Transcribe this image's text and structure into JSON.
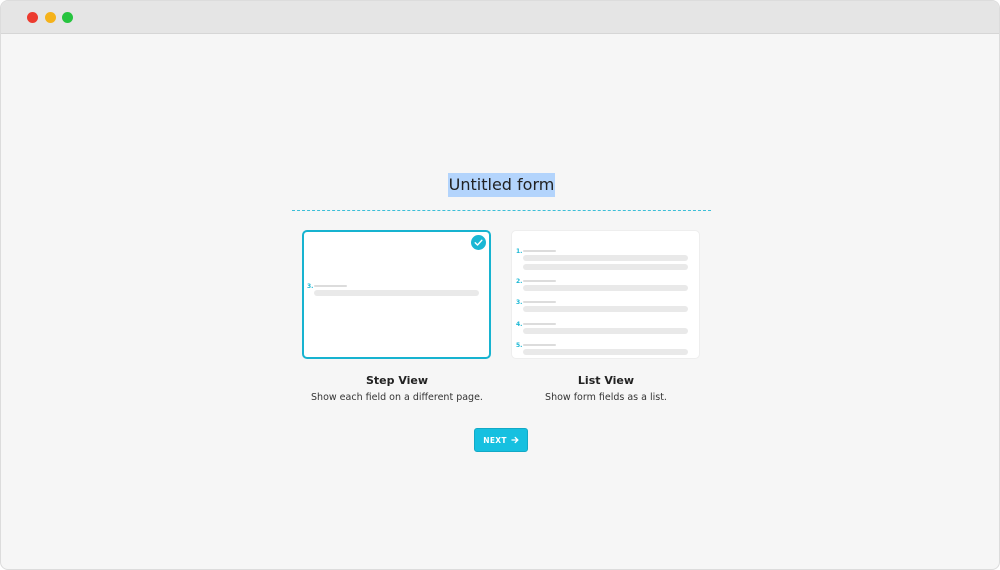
{
  "form": {
    "title": "Untitled form"
  },
  "views": {
    "step": {
      "title": "Step View",
      "description": "Show each field on a different page.",
      "selected": true,
      "preview_number": "3."
    },
    "list": {
      "title": "List View",
      "description": "Show form fields as a list.",
      "selected": false,
      "preview_numbers": [
        "1.",
        "2.",
        "3.",
        "4.",
        "5."
      ]
    }
  },
  "actions": {
    "next_label": "NEXT"
  },
  "colors": {
    "accent": "#17b3d0",
    "button": "#16c0e0",
    "selection_highlight": "#b3d4fc"
  },
  "icons": {
    "selected": "checkmark-icon",
    "next": "arrow-right-icon"
  }
}
